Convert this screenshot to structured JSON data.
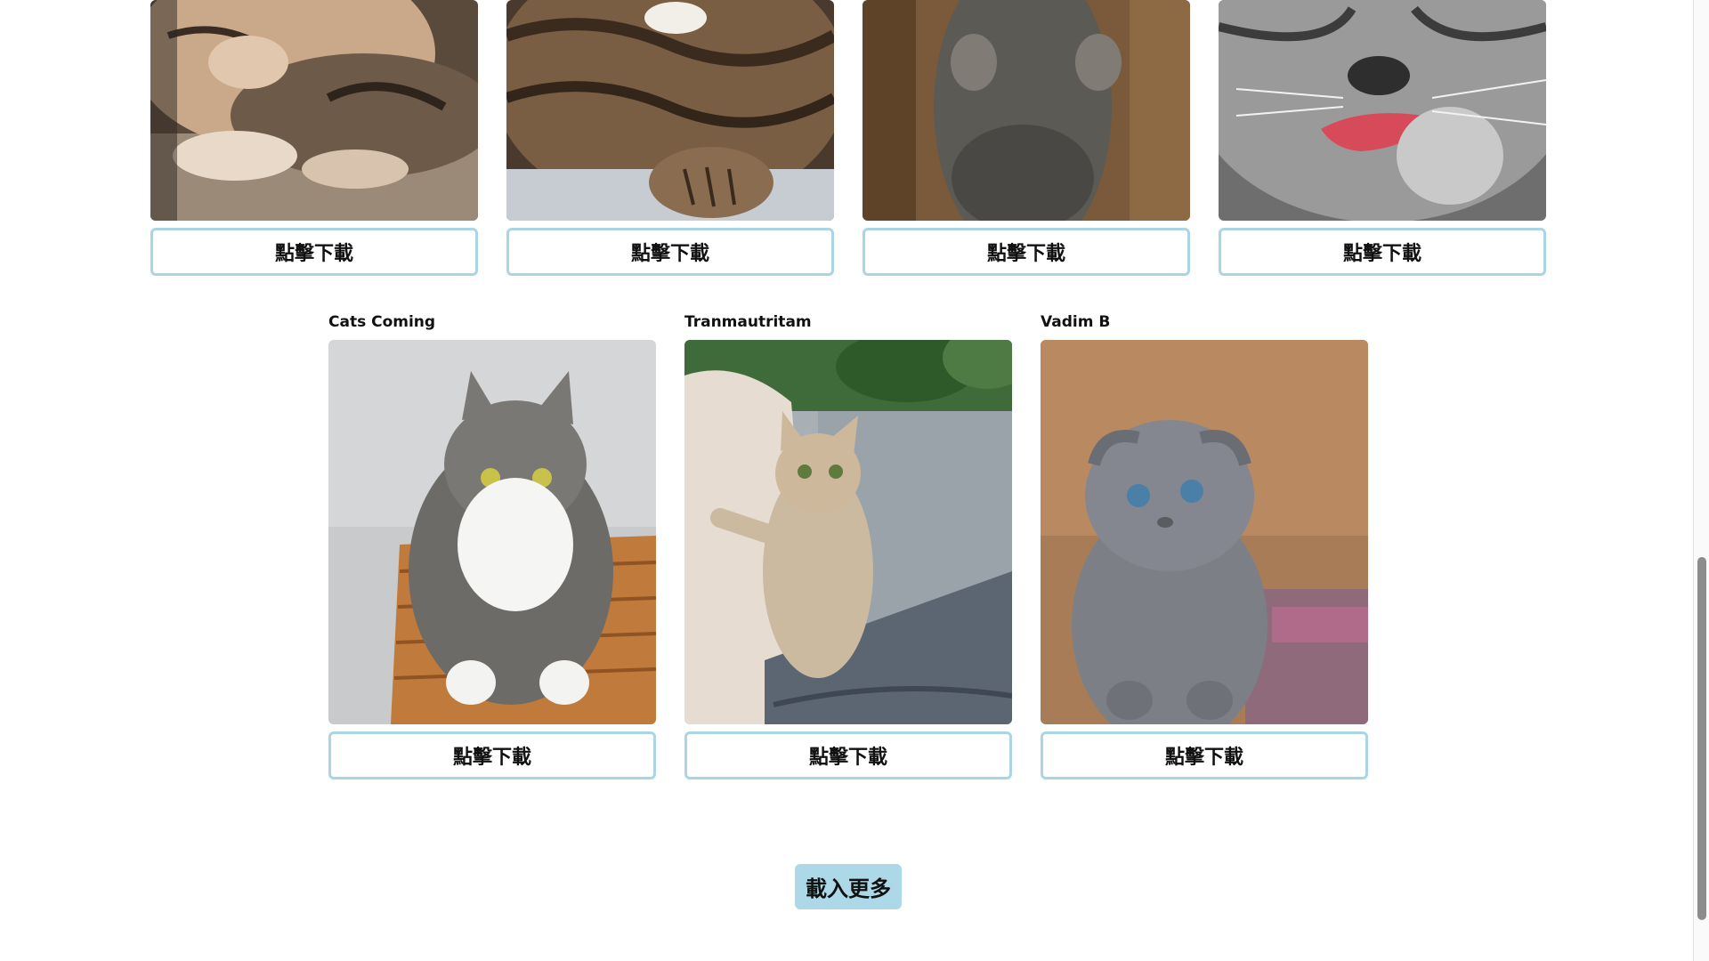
{
  "gallery": {
    "download_label": "點擊下載",
    "top_row": [
      {
        "image": "cat-sleeping-tabby-photo"
      },
      {
        "image": "cat-tabby-paws-photo"
      },
      {
        "image": "cat-grey-standing-photo"
      },
      {
        "image": "cat-licking-paw-photo"
      }
    ],
    "bottom_row": [
      {
        "photographer": "Cats Coming",
        "image": "cat-grey-white-basket-photo"
      },
      {
        "photographer": "Tranmautritam",
        "image": "kitten-on-sofa-photo"
      },
      {
        "photographer": "Vadim B",
        "image": "grey-scottish-fold-kitten-photo"
      }
    ]
  },
  "load_more_label": "載入更多",
  "colors": {
    "button_border": "#a9d6e5",
    "load_more_bg": "#acd8e8"
  }
}
